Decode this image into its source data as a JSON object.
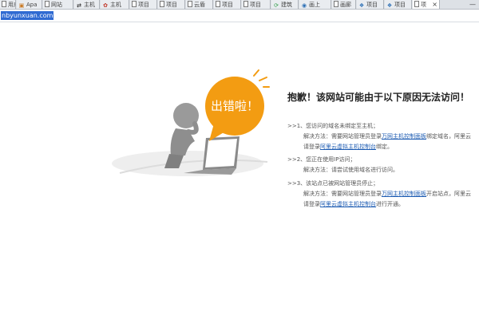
{
  "tabs": [
    {
      "icon": "page-icon",
      "label": "用户"
    },
    {
      "icon": "image-icon",
      "label": "Apa"
    },
    {
      "icon": "page-icon",
      "label": "网站"
    },
    {
      "icon": "sync-icon",
      "label": "主机"
    },
    {
      "icon": "paw-icon",
      "label": "主机"
    },
    {
      "icon": "page-icon",
      "label": "项目"
    },
    {
      "icon": "page-icon",
      "label": "项目"
    },
    {
      "icon": "page-icon",
      "label": "云盾"
    },
    {
      "icon": "page-icon",
      "label": "项目"
    },
    {
      "icon": "page-icon",
      "label": "项目"
    },
    {
      "icon": "leaf-icon",
      "label": "建筑"
    },
    {
      "icon": "bird-icon",
      "label": "画上"
    },
    {
      "icon": "page-icon",
      "label": "画廊"
    },
    {
      "icon": "wolf-icon",
      "label": "项目"
    },
    {
      "icon": "wolf-icon",
      "label": "项目"
    },
    {
      "icon": "page-icon",
      "label": "项"
    }
  ],
  "address_bar": {
    "url": "nbyunxuan.com"
  },
  "illustration": {
    "bubble_text": "出错啦！"
  },
  "message": {
    "title": "抱歉！该网站可能由于以下原因无法访问！",
    "reasons": [
      {
        "head": ">>1、您访问的域名未绑定至主机；",
        "line1_prefix": "解决方法：需要网站管理员登录",
        "line1_link": "万网主机控制面板",
        "line1_suffix": "绑定域名，阿里云",
        "line2_prefix": "请登录",
        "line2_link": "阿里云虚拟主机控制台",
        "line2_suffix": "绑定。"
      },
      {
        "head": ">>2、您正在使用IP访问；",
        "line1_prefix": "解决方法：请尝试使用域名进行访问。"
      },
      {
        "head": ">>3、该站点已被网站管理员停止；",
        "line1_prefix": "解决方法：需要网站管理员登录",
        "line1_link": "万网主机控制面板",
        "line1_suffix": "开启站点，阿里云",
        "line2_prefix": "请登录",
        "line2_link": "阿里云虚拟主机控制台",
        "line2_suffix": "进行开通。"
      }
    ]
  },
  "colors": {
    "accent": "#f39c12",
    "link": "#1f5db3",
    "url_highlight": "#2f6ad2"
  }
}
